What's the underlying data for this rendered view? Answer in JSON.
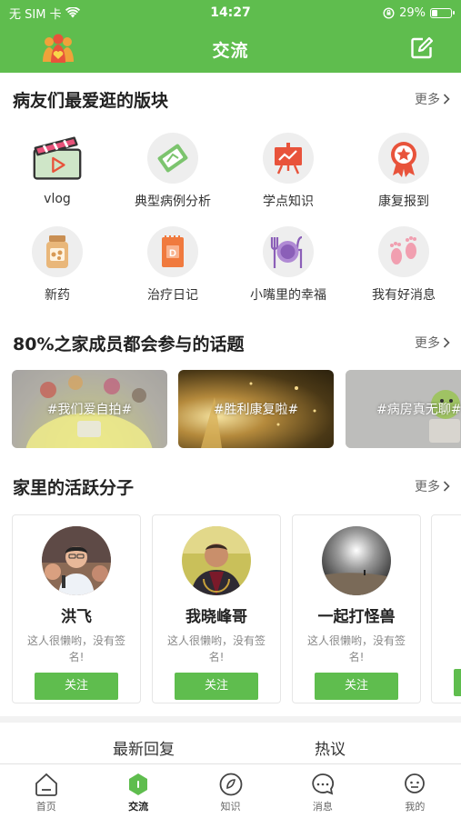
{
  "status": {
    "carrier": "无 SIM 卡",
    "time": "14:27",
    "battery": "29%",
    "battery_level": 0.29
  },
  "header": {
    "title": "交流"
  },
  "sections": {
    "boards": {
      "title": "病友们最爱逛的版块",
      "more": "更多"
    },
    "topics": {
      "title": "80%之家成员都会参与的话题",
      "more": "更多"
    },
    "active": {
      "title": "家里的活跃分子",
      "more": "更多"
    }
  },
  "categories": [
    {
      "label": "vlog",
      "icon": "clapperboard-icon"
    },
    {
      "label": "典型病例分析",
      "icon": "case-analysis-icon"
    },
    {
      "label": "学点知识",
      "icon": "presentation-board-icon"
    },
    {
      "label": "康复报到",
      "icon": "award-ribbon-icon"
    },
    {
      "label": "新药",
      "icon": "pill-bottle-icon"
    },
    {
      "label": "治疗日记",
      "icon": "diary-icon"
    },
    {
      "label": "小嘴里的幸福",
      "icon": "plate-cutlery-icon"
    },
    {
      "label": "我有好消息",
      "icon": "footprints-icon"
    }
  ],
  "topics": [
    {
      "label": "#我们爱自拍#"
    },
    {
      "label": "#胜利康复啦#"
    },
    {
      "label": "#病房真无聊#"
    }
  ],
  "members": [
    {
      "name": "洪飞",
      "signature": "这人很懒哟，没有签名!",
      "follow": "关注"
    },
    {
      "name": "我晓峰哥",
      "signature": "这人很懒哟，没有签名!",
      "follow": "关注"
    },
    {
      "name": "一起打怪兽",
      "signature": "这人很懒哟，没有签名!",
      "follow": "关注"
    }
  ],
  "feed_tabs": [
    "最新回复",
    "热议"
  ],
  "bottom_tabs": [
    {
      "label": "首页",
      "icon": "home-icon"
    },
    {
      "label": "交流",
      "icon": "exchange-icon"
    },
    {
      "label": "知识",
      "icon": "knowledge-icon"
    },
    {
      "label": "消息",
      "icon": "message-icon"
    },
    {
      "label": "我的",
      "icon": "profile-icon"
    }
  ],
  "colors": {
    "brand": "#5fbd4e"
  }
}
